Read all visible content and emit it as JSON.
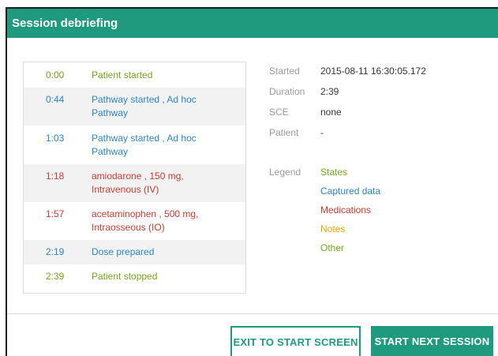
{
  "dialog": {
    "title": "Session debriefing"
  },
  "events": [
    {
      "time": "0:00",
      "description": "Patient started",
      "category": "states"
    },
    {
      "time": "0:44",
      "description": "Pathway started , Ad hoc Pathway",
      "category": "captured"
    },
    {
      "time": "1:03",
      "description": "Pathway started , Ad hoc Pathway",
      "category": "captured"
    },
    {
      "time": "1:18",
      "description": "amiodarone , 150 mg, Intravenous (IV)",
      "category": "medications"
    },
    {
      "time": "1:57",
      "description": "acetaminophen , 500 mg, Intraosseous (IO)",
      "category": "medications"
    },
    {
      "time": "2:19",
      "description": "Dose prepared",
      "category": "captured"
    },
    {
      "time": "2:39",
      "description": "Patient stopped",
      "category": "states"
    }
  ],
  "session_info": [
    {
      "label": "Started",
      "value": "2015-08-11 16:30:05.172"
    },
    {
      "label": "Duration",
      "value": "2:39"
    },
    {
      "label": "SCE",
      "value": "none"
    },
    {
      "label": "Patient",
      "value": "-"
    }
  ],
  "legend": {
    "label": "Legend",
    "items": [
      {
        "name": "States",
        "color": "#74a320"
      },
      {
        "name": "Captured data",
        "color": "#2d84c4"
      },
      {
        "name": "Medications",
        "color": "#c93b30"
      },
      {
        "name": "Notes",
        "color": "#f0a400"
      },
      {
        "name": "Other",
        "color": "#74a320"
      }
    ]
  },
  "buttons": {
    "exit_label": "EXIT TO START SCREEN",
    "next_label": "START NEXT SESSION"
  },
  "colors": {
    "accent": "#1f9a7f"
  }
}
